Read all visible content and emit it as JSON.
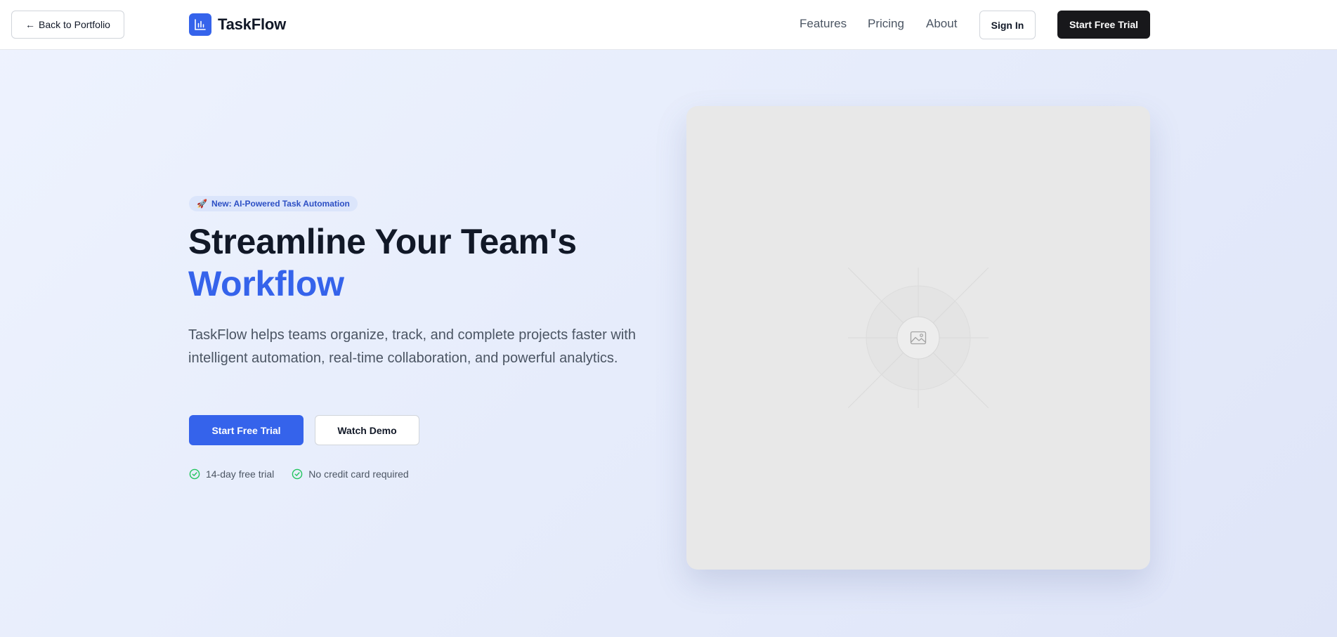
{
  "header": {
    "back_label": "Back to Portfolio",
    "brand": "TaskFlow",
    "nav": [
      "Features",
      "Pricing",
      "About"
    ],
    "signin_label": "Sign In",
    "trial_label": "Start Free Trial"
  },
  "hero": {
    "badge": "New: AI-Powered Task Automation",
    "badge_emoji": "🚀",
    "title_line1": "Streamline Your Team's",
    "title_line2": "Workflow",
    "description": "TaskFlow helps teams organize, track, and complete projects faster with intelligent automation, real-time collaboration, and powerful analytics.",
    "primary_cta": "Start Free Trial",
    "secondary_cta": "Watch Demo",
    "perks": [
      "14-day free trial",
      "No credit card required"
    ]
  },
  "icons": {
    "back": "arrow-left-icon",
    "logo": "bar-chart-icon",
    "badge": "rocket-icon",
    "perk": "check-circle-icon",
    "placeholder": "image-icon"
  },
  "colors": {
    "primary": "#3563eb",
    "dark": "#18181b",
    "check": "#22c55e"
  }
}
